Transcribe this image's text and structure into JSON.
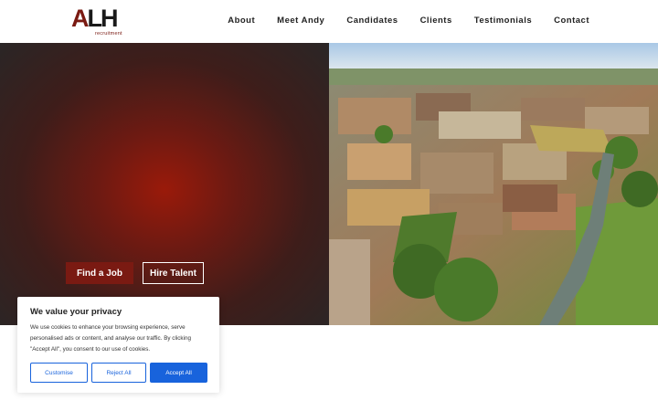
{
  "header": {
    "logo": {
      "mark_a": "A",
      "mark_lh": "LH",
      "sub": "recruitment"
    },
    "nav": [
      {
        "label": "About"
      },
      {
        "label": "Meet Andy"
      },
      {
        "label": "Candidates"
      },
      {
        "label": "Clients"
      },
      {
        "label": "Testimonials"
      },
      {
        "label": "Contact"
      }
    ]
  },
  "hero": {
    "find_job_label": "Find a Job",
    "hire_talent_label": "Hire Talent"
  },
  "cookie": {
    "title": "We value your privacy",
    "text": "We use cookies to enhance your browsing experience, serve personalised ads or content, and analyse our traffic. By clicking \"Accept All\", you consent to our use of cookies.",
    "customise_label": "Customise",
    "reject_label": "Reject All",
    "accept_label": "Accept All"
  },
  "colors": {
    "brand": "#7a1a12",
    "consent_accent": "#1863dc"
  }
}
